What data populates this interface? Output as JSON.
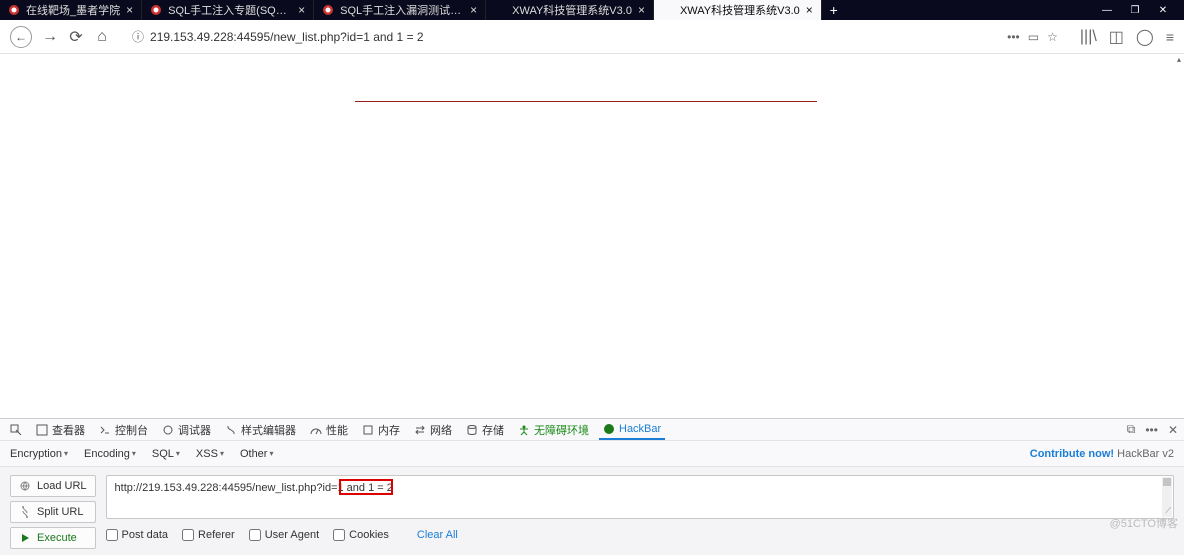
{
  "tabs": [
    {
      "title": "在线靶场_墨者学院",
      "active": false,
      "favicon": "mozhe"
    },
    {
      "title": "SQL手工注入专题(SQL Injectio",
      "active": false,
      "favicon": "mozhe"
    },
    {
      "title": "SQL手工注入漏洞测试(MySQL",
      "active": false,
      "favicon": "mozhe"
    },
    {
      "title": "XWAY科技管理系统V3.0",
      "active": false,
      "favicon": "none"
    },
    {
      "title": "XWAY科技管理系统V3.0",
      "active": true,
      "favicon": "none"
    }
  ],
  "url": "219.153.49.228:44595/new_list.php?id=1 and 1 = 2",
  "windowControls": {
    "min": "—",
    "max": "❐",
    "close": "✕"
  },
  "nav": {
    "back": "←",
    "forward": "→",
    "reload": "⟳",
    "home": "⌂"
  },
  "urlIcons": {
    "dots": "•••",
    "reader": "▭",
    "star": "☆"
  },
  "rightIcons": {
    "library": "|||\\",
    "sidebar": "◫",
    "account": "◯",
    "menu": "≡"
  },
  "devtools": [
    {
      "id": "picker",
      "label": "",
      "icon": "picker"
    },
    {
      "id": "inspector",
      "label": "查看器",
      "icon": "box"
    },
    {
      "id": "console",
      "label": "控制台",
      "icon": "console"
    },
    {
      "id": "debugger",
      "label": "调试器",
      "icon": "debug"
    },
    {
      "id": "style",
      "label": "样式编辑器",
      "icon": "style"
    },
    {
      "id": "perf",
      "label": "性能",
      "icon": "perf"
    },
    {
      "id": "memory",
      "label": "内存",
      "icon": "memory"
    },
    {
      "id": "network",
      "label": "网络",
      "icon": "network"
    },
    {
      "id": "storage",
      "label": "存储",
      "icon": "storage"
    },
    {
      "id": "accessibility",
      "label": "无障碍环境",
      "icon": "acc"
    },
    {
      "id": "hackbar",
      "label": "HackBar",
      "icon": "hackbar"
    }
  ],
  "hackbarMenus": [
    "Encryption",
    "Encoding",
    "SQL",
    "XSS",
    "Other"
  ],
  "hackbarRight": {
    "contribute": "Contribute now!",
    "brand": "HackBar v2"
  },
  "hackButtons": {
    "load": "Load URL",
    "split": "Split URL",
    "execute": "Execute"
  },
  "hackUrl": "http://219.153.49.228:44595/new_list.php?id=1 and 1 = 2",
  "hackChecks": [
    "Post data",
    "Referer",
    "User Agent",
    "Cookies"
  ],
  "clearAll": "Clear All",
  "watermark": "@51CTO博客"
}
